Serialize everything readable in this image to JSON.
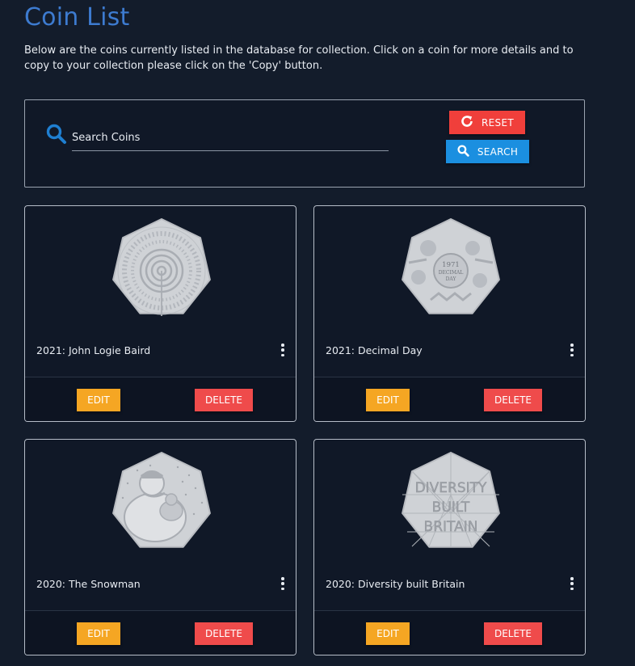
{
  "page": {
    "title": "Coin List",
    "intro": "Below are the coins currently listed in the database for collection. Click on a coin for more details and to copy to your collection please click on the 'Copy' button."
  },
  "search": {
    "placeholder": "Search Coins",
    "value": "",
    "reset_label": "RESET",
    "search_label": "SEARCH"
  },
  "coins": [
    {
      "title": "2021: John Logie Baird",
      "image": "john-logie-baird-coin",
      "edit_label": "EDIT",
      "delete_label": "DELETE"
    },
    {
      "title": "2021: Decimal Day",
      "image": "decimal-day-coin",
      "edit_label": "EDIT",
      "delete_label": "DELETE"
    },
    {
      "title": "2020: The Snowman",
      "image": "snowman-coin",
      "edit_label": "EDIT",
      "delete_label": "DELETE"
    },
    {
      "title": "2020: Diversity built Britain",
      "image": "diversity-built-britain-coin",
      "edit_label": "EDIT",
      "delete_label": "DELETE"
    }
  ],
  "coin_lettering": {
    "decimal_day": [
      "1971",
      "DECIMAL",
      "DAY"
    ],
    "diversity": [
      "DIVERSITY",
      "BUILT",
      "BRITAIN"
    ]
  },
  "colors": {
    "background": "#131c2b",
    "title": "#3d7bd0",
    "reset": "#f03f3b",
    "search": "#1b8fe0",
    "edit": "#f5a623",
    "delete": "#ef4b4b"
  }
}
